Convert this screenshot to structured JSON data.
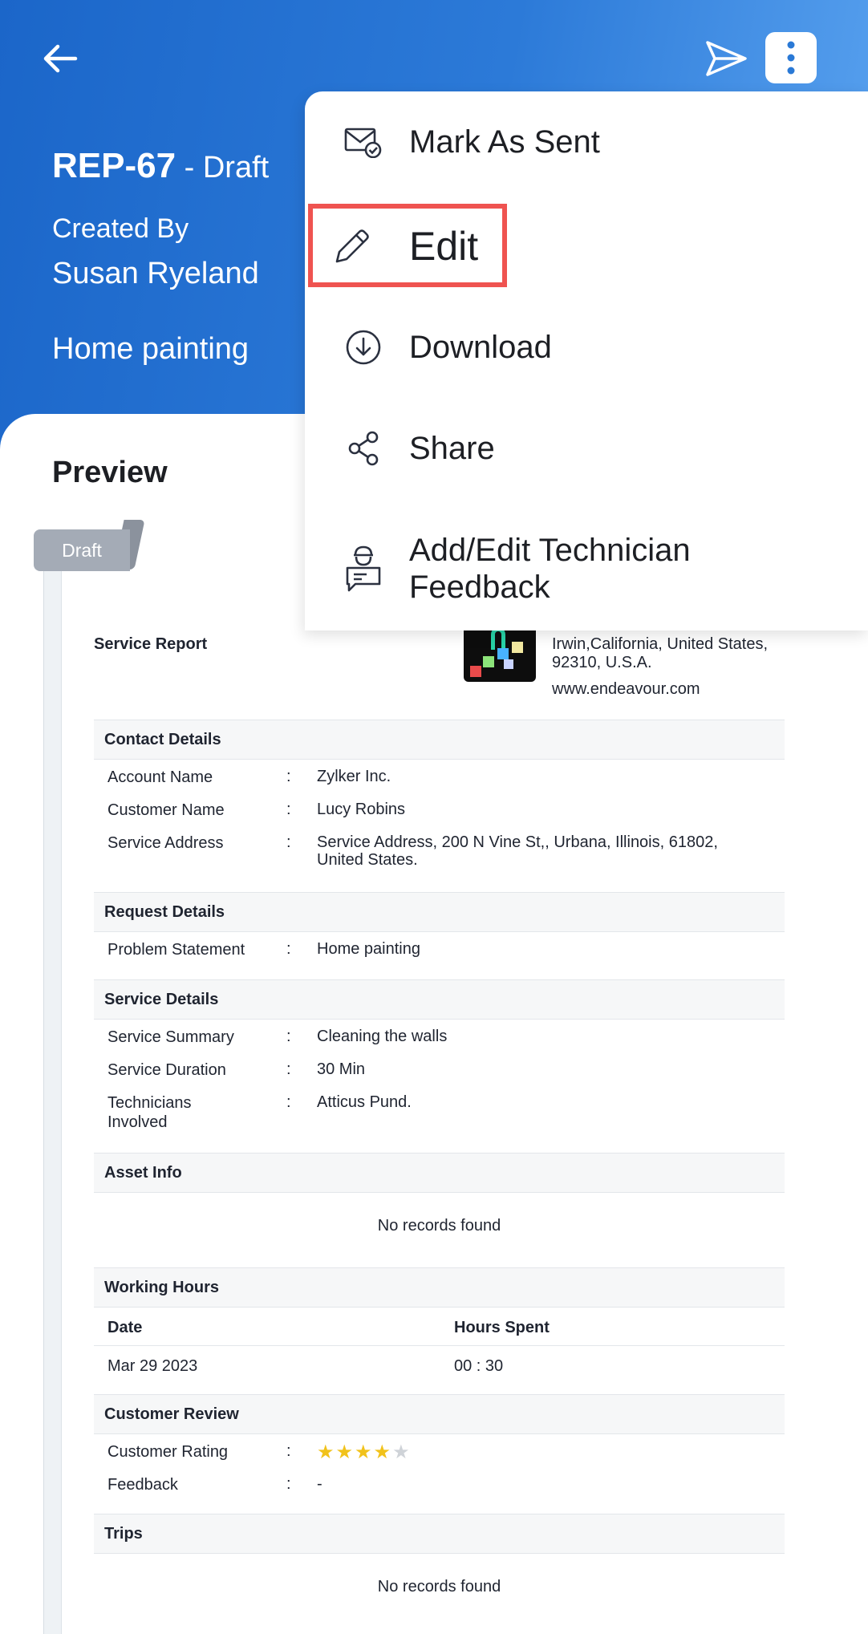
{
  "header": {
    "record_id": "REP-67",
    "status": " - Draft",
    "created_by_label": "Created By",
    "created_by_name": "Susan Ryeland",
    "subject": "Home painting"
  },
  "preview": {
    "title": "Preview",
    "draft_tag": "Draft"
  },
  "report": {
    "title": "Service Report",
    "company_address": "Irwin,California, United States, 92310, U.S.A.",
    "company_website": "www.endeavour.com",
    "contact": {
      "heading": "Contact Details",
      "rows": [
        {
          "label": "Account Name",
          "value": "Zylker Inc."
        },
        {
          "label": "Customer Name",
          "value": "Lucy Robins"
        },
        {
          "label": "Service Address",
          "value": "Service Address, 200 N Vine St,, Urbana, Illinois, 61802, United States."
        }
      ]
    },
    "request": {
      "heading": "Request Details",
      "rows": [
        {
          "label": "Problem Statement",
          "value": "Home painting"
        }
      ]
    },
    "service": {
      "heading": "Service Details",
      "rows": [
        {
          "label": "Service Summary",
          "value": "Cleaning the walls"
        },
        {
          "label": "Service Duration",
          "value": "30 Min"
        },
        {
          "label": "Technicians Involved",
          "value": "Atticus Pund."
        }
      ]
    },
    "asset": {
      "heading": "Asset Info",
      "empty": "No records found"
    },
    "working_hours": {
      "heading": "Working Hours",
      "columns": [
        "Date",
        "Hours Spent"
      ],
      "rows": [
        {
          "date": "Mar 29 2023",
          "hours": "00 : 30"
        }
      ]
    },
    "review": {
      "heading": "Customer Review",
      "rating_label": "Customer Rating",
      "rating": 4,
      "rating_max": 5,
      "feedback_label": "Feedback",
      "feedback_value": "-"
    },
    "trips": {
      "heading": "Trips",
      "empty": "No records found"
    },
    "separator": ":"
  },
  "menu": {
    "items": [
      {
        "label": "Mark As Sent",
        "icon": "mail-check-icon"
      },
      {
        "label": "Edit",
        "icon": "pencil-icon"
      },
      {
        "label": "Download",
        "icon": "download-circle-icon"
      },
      {
        "label": "Share",
        "icon": "share-icon"
      },
      {
        "label": "Add/Edit Technician Feedback",
        "icon": "technician-feedback-icon"
      }
    ]
  },
  "colors": {
    "header_gradient_start": "#1b66c9",
    "header_gradient_end": "#5aa3f0",
    "highlight": "#ef5350",
    "star": "#f1c21b"
  }
}
